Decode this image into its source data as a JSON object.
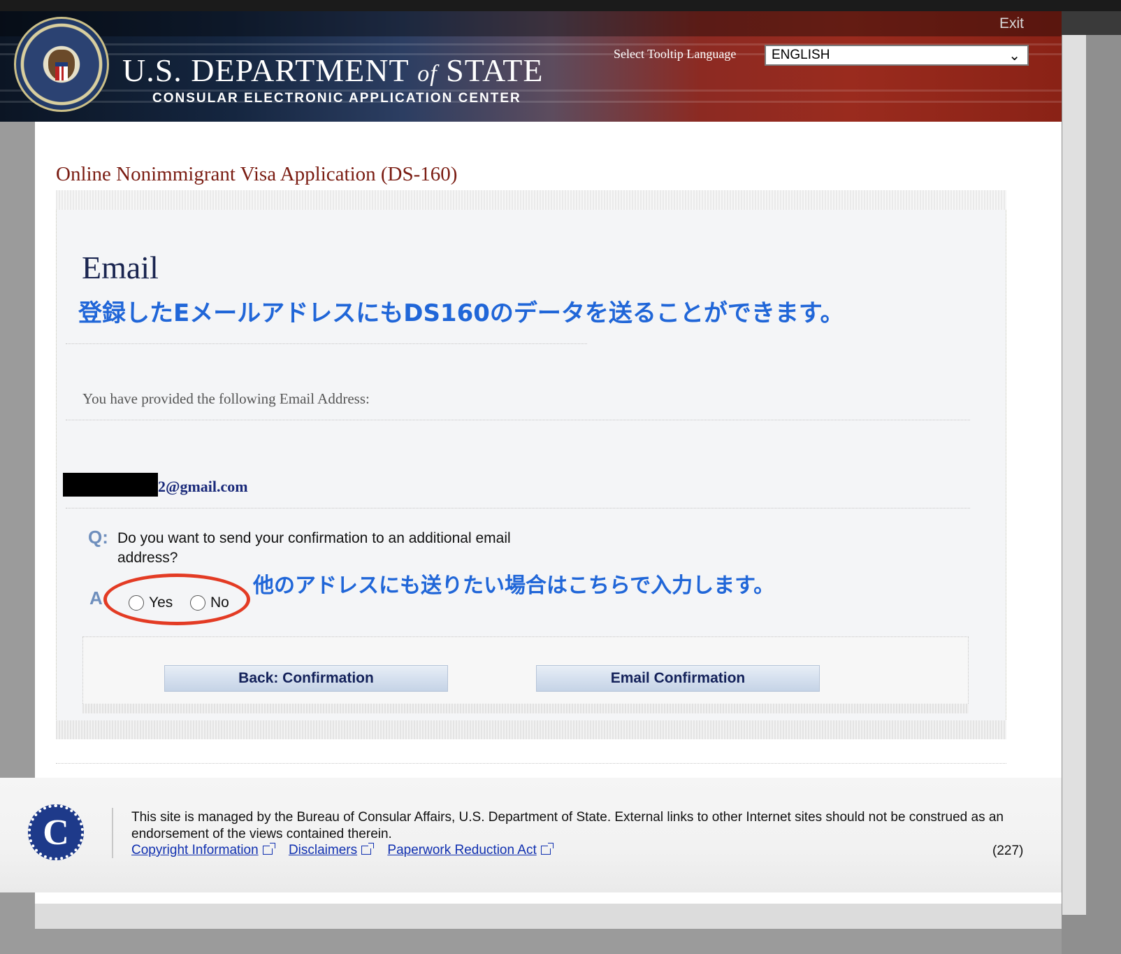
{
  "header": {
    "exit_label": "Exit",
    "dept_title_part1": "U.S. DEPARTMENT",
    "dept_title_of": "of",
    "dept_title_part2": "STATE",
    "dept_subtitle": "CONSULAR ELECTRONIC APPLICATION CENTER",
    "tooltip_language_label": "Select Tooltip Language",
    "tooltip_language_value": "ENGLISH"
  },
  "main": {
    "app_title": "Online Nonimmigrant Visa Application (DS-160)",
    "section_heading": "Email",
    "annotation_top": "登録したEメールアドレスにもDS160のデータを送ることができます。",
    "provided_text": "You have provided the following Email Address:",
    "email_visible_part": "2@gmail.com",
    "question_label": "Q:",
    "question_text": "Do you want to send your confirmation to an additional email address?",
    "answer_label": "A:",
    "options": [
      "Yes",
      "No"
    ],
    "annotation_bottom": "他のアドレスにも送りたい場合はこちらで入力します。",
    "back_button": "Back: Confirmation",
    "email_button": "Email Confirmation"
  },
  "footer": {
    "logo_letter": "C",
    "managed_text": "This site is managed by the Bureau of Consular Affairs, U.S. Department of State. External links to other Internet sites should not be construed as an endorsement of the views contained therein.",
    "links": [
      "Copyright Information",
      "Disclaimers",
      "Paperwork Reduction Act"
    ],
    "page_number": "(227)"
  },
  "colors": {
    "annotation_blue": "#2066d8",
    "highlight_red": "#e33b24",
    "title_maroon": "#7a1c12",
    "heading_navy": "#1a2550"
  }
}
